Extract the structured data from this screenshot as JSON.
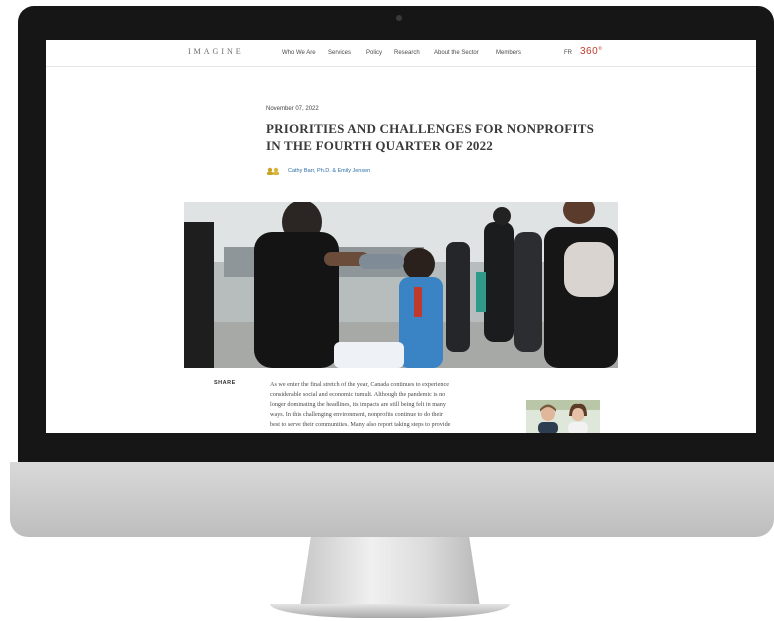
{
  "header": {
    "logo": "IMAGINE",
    "nav": [
      "Who We Are",
      "Services",
      "Policy",
      "Research",
      "About the Sector",
      "Members"
    ],
    "lang": "FR",
    "badge": "360°"
  },
  "article": {
    "date": "November 07, 2022",
    "title": "PRIORITIES AND CHALLENGES FOR NONPROFITS IN THE FOURTH QUARTER OF 2022",
    "authors": "Cathy Barr, Ph.D. & Emily Jensen",
    "share_label": "SHARE",
    "body_lines": [
      "As we enter the final stretch of the year, Canada continues to experience",
      "considerable social and economic tumult. Although the pandemic is no",
      "longer dominating the headlines, its impacts are still being felt in many",
      "ways. In this challenging environment, nonprofits continue to do their",
      "best to serve their communities. Many also report taking steps to provide"
    ]
  }
}
